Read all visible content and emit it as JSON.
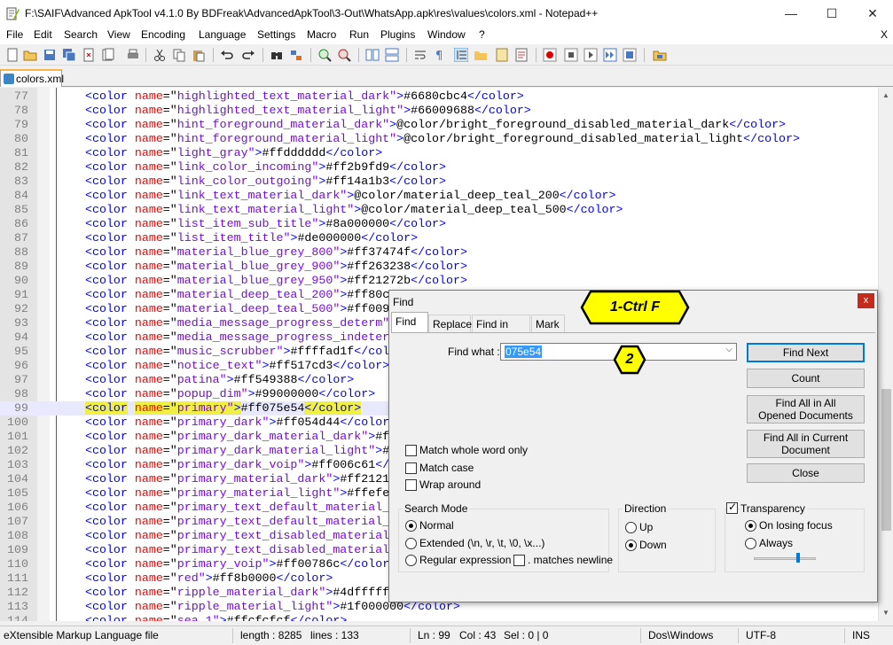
{
  "window": {
    "title": "F:\\SAIF\\Advanced ApkTool v4.1.0 By BDFreak\\AdvancedApkTool\\3-Out\\WhatsApp.apk\\res\\values\\colors.xml - Notepad++",
    "minimize": "—",
    "maximize": "☐",
    "close": "✕"
  },
  "menu": {
    "items": [
      "File",
      "Edit",
      "Search",
      "View",
      "Encoding",
      "Language",
      "Settings",
      "Macro",
      "Run",
      "Plugins",
      "Window",
      "?"
    ],
    "close": "X"
  },
  "tab": {
    "label": "colors.xml"
  },
  "editor": {
    "lines": [
      {
        "n": "77",
        "name": "highlighted_text_material_dark",
        "value": "#6680cbc4"
      },
      {
        "n": "78",
        "name": "highlighted_text_material_light",
        "value": "#66009688"
      },
      {
        "n": "79",
        "name": "hint_foreground_material_dark",
        "value": "@color/bright_foreground_disabled_material_dark"
      },
      {
        "n": "80",
        "name": "hint_foreground_material_light",
        "value": "@color/bright_foreground_disabled_material_light"
      },
      {
        "n": "81",
        "name": "light_gray",
        "value": "#ffdddddd"
      },
      {
        "n": "82",
        "name": "link_color_incoming",
        "value": "#ff2b9fd9"
      },
      {
        "n": "83",
        "name": "link_color_outgoing",
        "value": "#ff14a1b3"
      },
      {
        "n": "84",
        "name": "link_text_material_dark",
        "value": "@color/material_deep_teal_200"
      },
      {
        "n": "85",
        "name": "link_text_material_light",
        "value": "@color/material_deep_teal_500"
      },
      {
        "n": "86",
        "name": "list_item_sub_title",
        "value": "#8a000000"
      },
      {
        "n": "87",
        "name": "list_item_title",
        "value": "#de000000"
      },
      {
        "n": "88",
        "name": "material_blue_grey_800",
        "value": "#ff37474f"
      },
      {
        "n": "89",
        "name": "material_blue_grey_900",
        "value": "#ff263238"
      },
      {
        "n": "90",
        "name": "material_blue_grey_950",
        "value": "#ff21272b"
      },
      {
        "n": "91",
        "name": "material_deep_teal_200",
        "value": "#ff80c"
      },
      {
        "n": "92",
        "name": "material_deep_teal_500",
        "value": "#ff009"
      },
      {
        "n": "93",
        "name": "media_message_progress_determ",
        "value": ""
      },
      {
        "n": "94",
        "name": "media_message_progress_indeter",
        "value": ""
      },
      {
        "n": "95",
        "name": "music_scrubber",
        "value": "#ffffad1f"
      },
      {
        "n": "96",
        "name": "notice_text",
        "value": "#ff517cd3"
      },
      {
        "n": "97",
        "name": "patina",
        "value": "#ff549388"
      },
      {
        "n": "98",
        "name": "popup_dim",
        "value": "#99000000"
      },
      {
        "n": "99",
        "name": "primary",
        "value": "#ff075e54",
        "selected": true
      },
      {
        "n": "100",
        "name": "primary_dark",
        "value": "#ff054d44"
      },
      {
        "n": "101",
        "name": "primary_dark_material_dark",
        "value": "#f"
      },
      {
        "n": "102",
        "name": "primary_dark_material_light",
        "value": "#"
      },
      {
        "n": "103",
        "name": "primary_dark_voip",
        "value": "#ff006c61"
      },
      {
        "n": "104",
        "name": "primary_material_dark",
        "value": "#ff2121"
      },
      {
        "n": "105",
        "name": "primary_material_light",
        "value": "#ffefe"
      },
      {
        "n": "106",
        "name": "primary_text_default_material_",
        "value": ""
      },
      {
        "n": "107",
        "name": "primary_text_default_material_",
        "value": ""
      },
      {
        "n": "108",
        "name": "primary_text_disabled_material",
        "value": ""
      },
      {
        "n": "109",
        "name": "primary_text_disabled_material",
        "value": ""
      },
      {
        "n": "110",
        "name": "primary_voip",
        "value": "#ff00786c"
      },
      {
        "n": "111",
        "name": "red",
        "value": "#ff8b0000"
      },
      {
        "n": "112",
        "name": "ripple_material_dark",
        "value": "#4dfffff"
      },
      {
        "n": "113",
        "name": "ripple_material_light",
        "value": "#1f000000"
      },
      {
        "n": "114",
        "name": "sea_1",
        "value": "#ffcfcfcf"
      }
    ]
  },
  "status": {
    "filetype": "eXtensible Markup Language file",
    "length": "length : 8285",
    "lines": "lines : 133",
    "ln": "Ln : 99",
    "col": "Col : 43",
    "sel": "Sel : 0 | 0",
    "eol": "Dos\\Windows",
    "encoding": "UTF-8",
    "mode": "INS"
  },
  "find": {
    "title": "Find",
    "close": "x",
    "tabs": [
      "Find",
      "Replace",
      "Find in Files",
      "Mark"
    ],
    "find_what_label": "Find what :",
    "find_what_value": "075e54",
    "buttons": {
      "find_next": "Find Next",
      "count": "Count",
      "find_all_opened": "Find All in All Opened Documents",
      "find_all_current": "Find All in Current Document",
      "close": "Close"
    },
    "options": {
      "whole_word": "Match whole word only",
      "match_case": "Match case",
      "wrap_around": "Wrap around"
    },
    "search_mode": {
      "label": "Search Mode",
      "normal": "Normal",
      "extended": "Extended (\\n, \\r, \\t, \\0, \\x...)",
      "regex": "Regular expression",
      "matches_newline": ". matches newline"
    },
    "direction": {
      "label": "Direction",
      "up": "Up",
      "down": "Down"
    },
    "transparency": {
      "label": "Transparency",
      "on_losing_focus": "On losing focus",
      "always": "Always"
    }
  },
  "annotations": {
    "callout1": "1-Ctrl F",
    "callout2": "2"
  },
  "colors": {
    "tag": "#0000ff",
    "attr": "#ff0000",
    "value": "#8000ff",
    "accent": "#0078d7",
    "callout": "#ffff00"
  }
}
